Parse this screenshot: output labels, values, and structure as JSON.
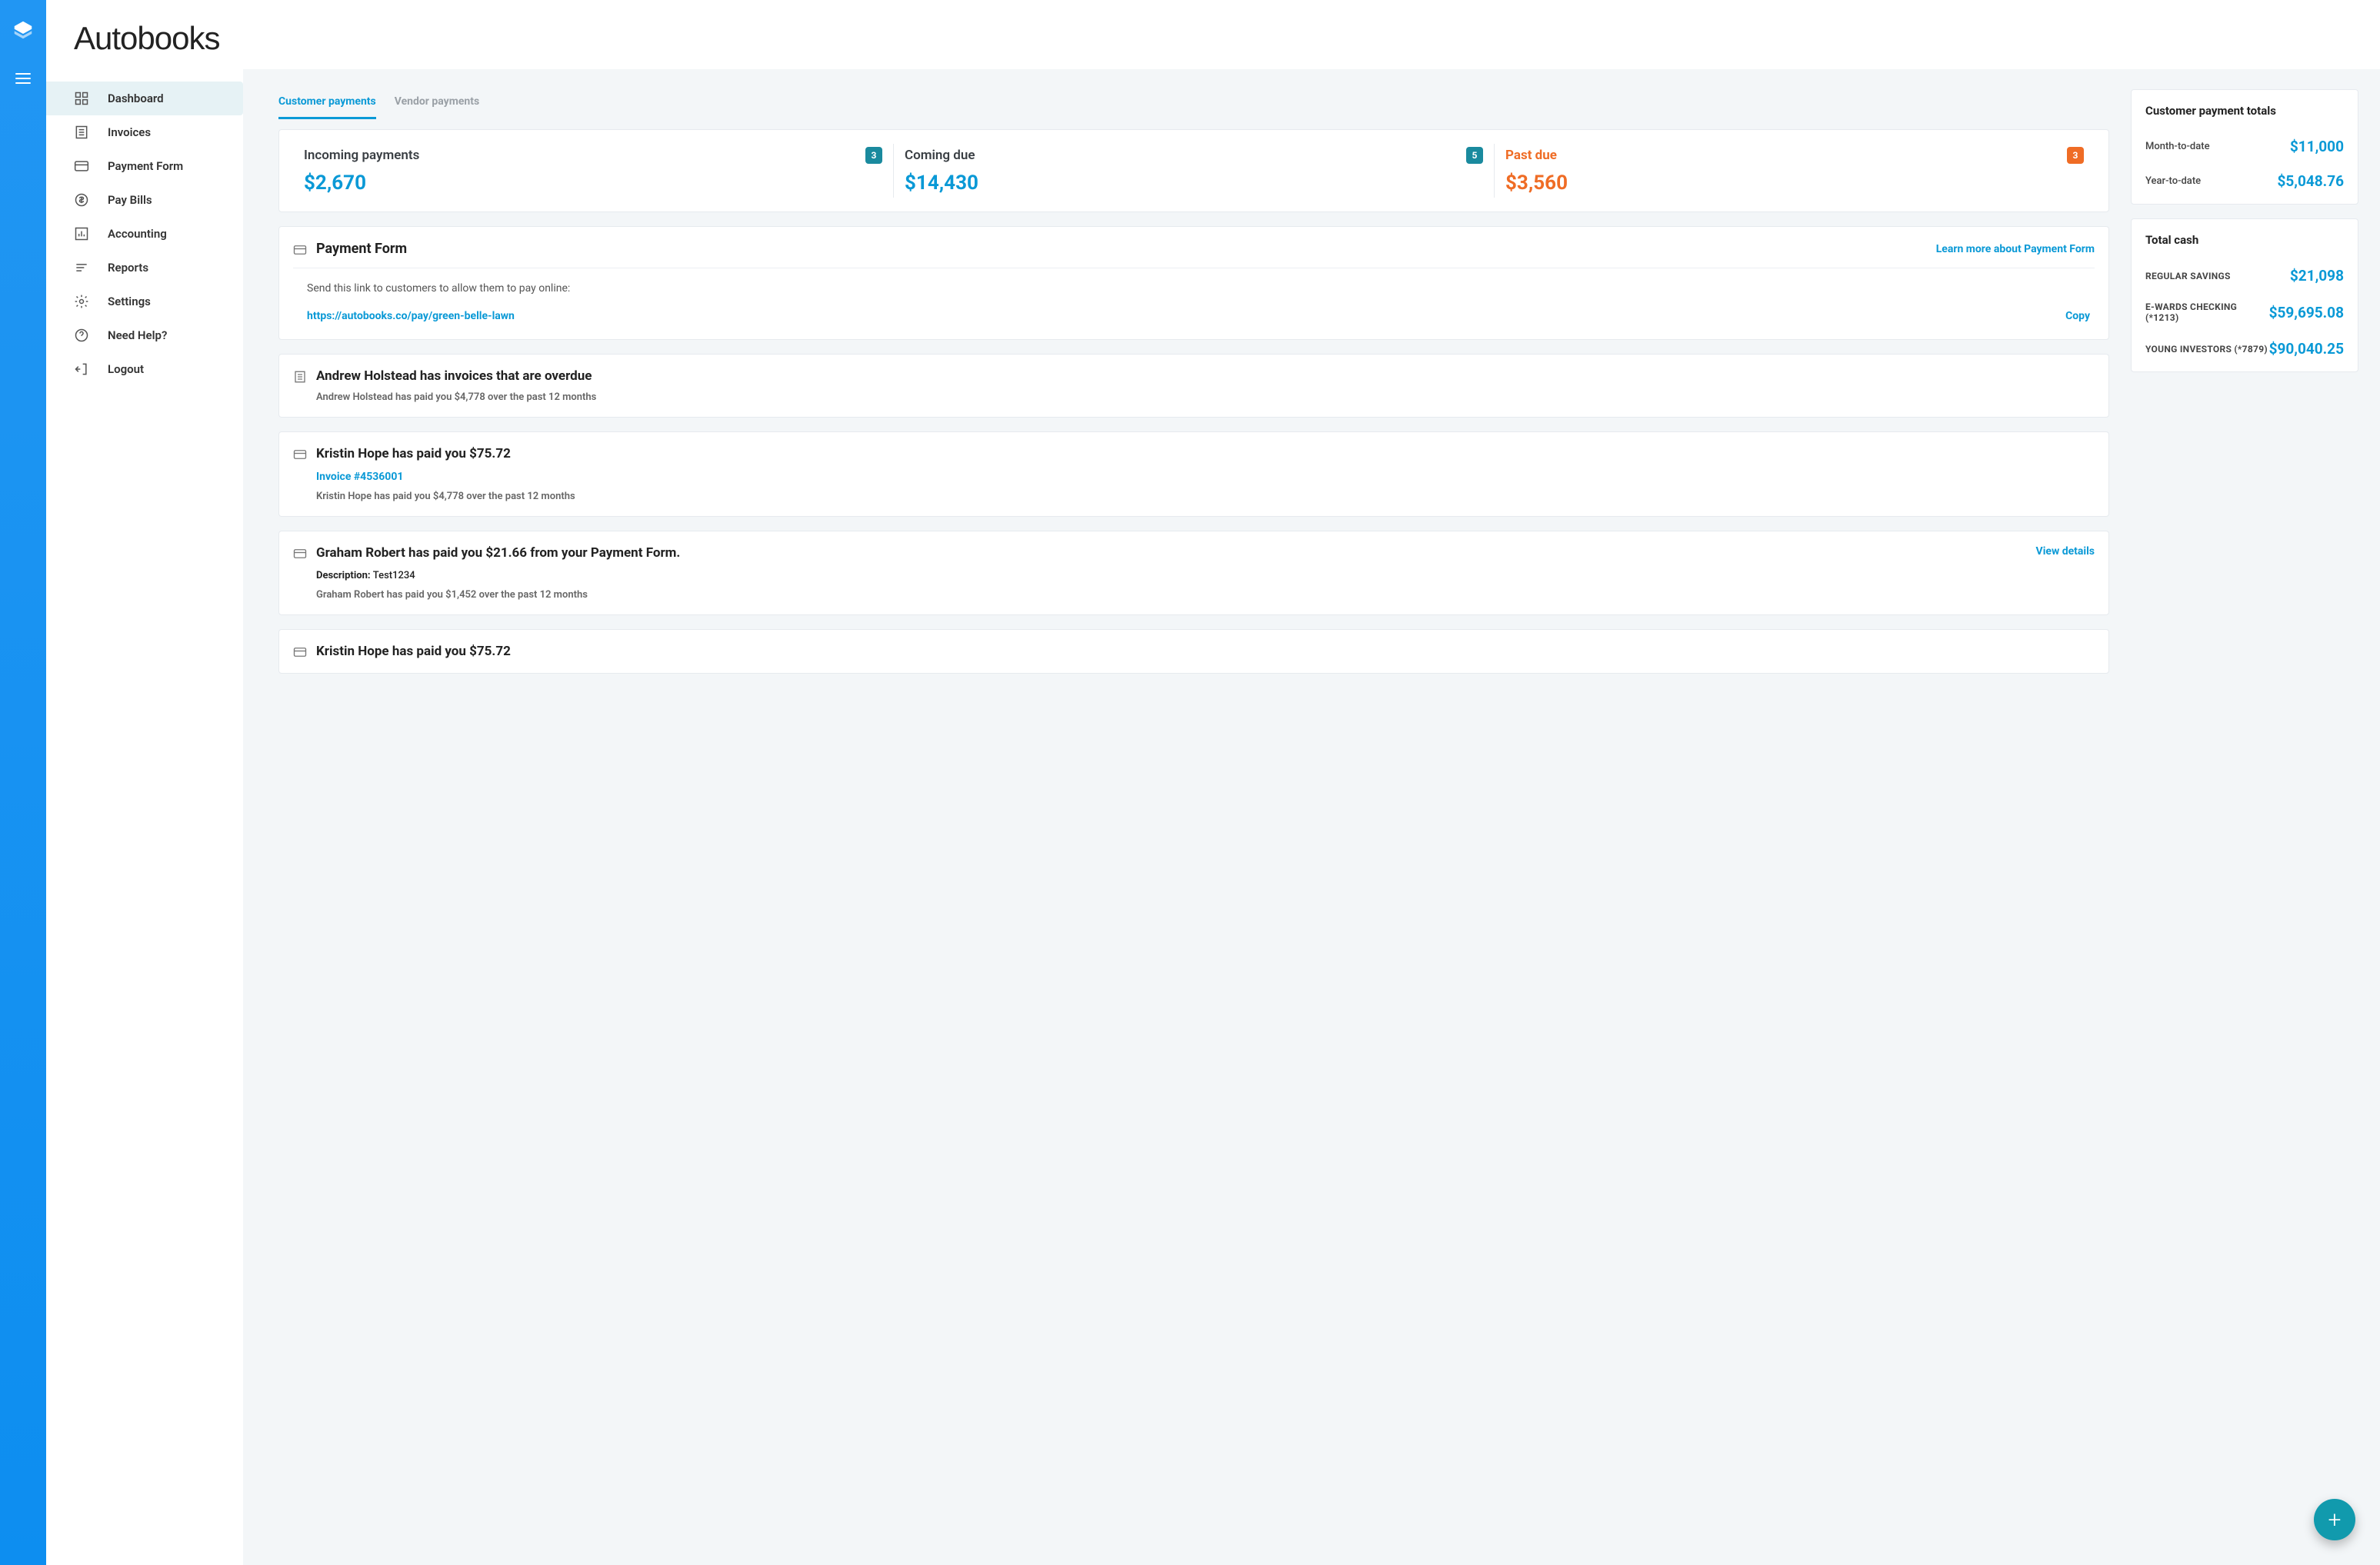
{
  "brand": "Autobooks",
  "nav": {
    "items": [
      {
        "label": "Dashboard"
      },
      {
        "label": "Invoices"
      },
      {
        "label": "Payment Form"
      },
      {
        "label": "Pay Bills"
      },
      {
        "label": "Accounting"
      },
      {
        "label": "Reports"
      },
      {
        "label": "Settings"
      },
      {
        "label": "Need Help?"
      },
      {
        "label": "Logout"
      }
    ]
  },
  "tabs": {
    "customer": "Customer payments",
    "vendor": "Vendor payments"
  },
  "summary": {
    "incoming": {
      "label": "Incoming payments",
      "count": "3",
      "amount": "$2,670"
    },
    "coming_due": {
      "label": "Coming due",
      "count": "5",
      "amount": "$14,430"
    },
    "past_due": {
      "label": "Past due",
      "count": "3",
      "amount": "$3,560"
    }
  },
  "payment_form": {
    "title": "Payment Form",
    "learn": "Learn more about Payment Form",
    "desc": "Send this link to customers to allow them to pay online:",
    "link": "https://autobooks.co/pay/green-belle-lawn",
    "copy": "Copy"
  },
  "activity": [
    {
      "title": "Andrew Holstead has invoices that are overdue",
      "sub": "Andrew Holstead has paid you $4,778 over the past 12 months",
      "icon": "list"
    },
    {
      "title": "Kristin Hope has paid you $75.72",
      "link": "Invoice #4536001",
      "sub": "Kristin Hope has paid you $4,778 over the past 12 months",
      "icon": "card"
    },
    {
      "title": "Graham Robert has paid you $21.66 from your Payment Form.",
      "desc_label": "Description:",
      "desc_value": "Test1234",
      "sub": "Graham Robert has paid you $1,452 over the past 12 months",
      "view": "View details",
      "icon": "card"
    },
    {
      "title": "Kristin Hope has paid you $75.72",
      "icon": "card"
    }
  ],
  "totals": {
    "title": "Customer payment totals",
    "mtd": {
      "label": "Month-to-date",
      "value": "$11,000"
    },
    "ytd": {
      "label": "Year-to-date",
      "value": "$5,048.76"
    }
  },
  "cash": {
    "title": "Total cash",
    "accounts": [
      {
        "label": "REGULAR SAVINGS",
        "value": "$21,098"
      },
      {
        "label": "E-WARDS CHECKING (*1213)",
        "value": "$59,695.08"
      },
      {
        "label": "YOUNG INVESTORS (*7879)",
        "value": "$90,040.25"
      }
    ]
  },
  "fab": "+"
}
